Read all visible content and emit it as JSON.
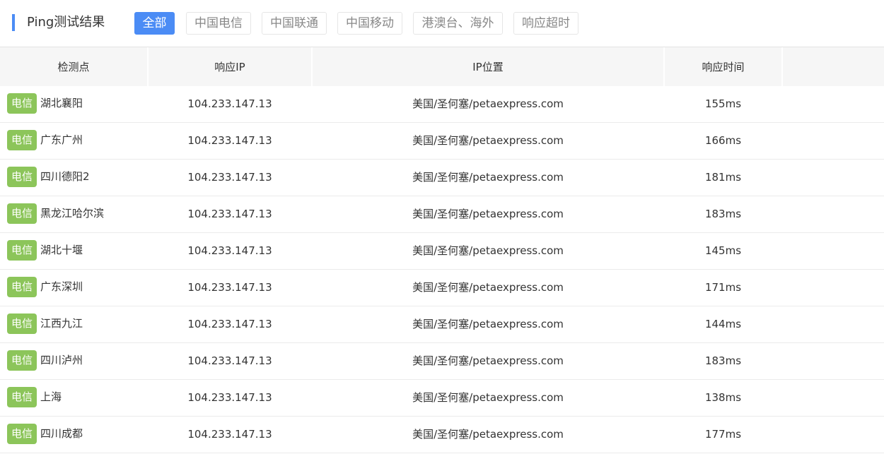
{
  "header": {
    "title": "Ping测试结果",
    "tabs": [
      {
        "label": "全部",
        "active": true
      },
      {
        "label": "中国电信",
        "active": false
      },
      {
        "label": "中国联通",
        "active": false
      },
      {
        "label": "中国移动",
        "active": false
      },
      {
        "label": "港澳台、海外",
        "active": false
      },
      {
        "label": "响应超时",
        "active": false
      }
    ]
  },
  "colors": {
    "accent": "#4b8cf5",
    "isp_badge": "#8cc55a",
    "header_bg": "#f6f6f6"
  },
  "table": {
    "columns": [
      "检测点",
      "响应IP",
      "IP位置",
      "响应时间"
    ],
    "rows": [
      {
        "isp": "电信",
        "point": "湖北襄阳",
        "ip": "104.233.147.13",
        "location": "美国/圣何塞/petaexpress.com",
        "time": "155ms"
      },
      {
        "isp": "电信",
        "point": "广东广州",
        "ip": "104.233.147.13",
        "location": "美国/圣何塞/petaexpress.com",
        "time": "166ms"
      },
      {
        "isp": "电信",
        "point": "四川德阳2",
        "ip": "104.233.147.13",
        "location": "美国/圣何塞/petaexpress.com",
        "time": "181ms"
      },
      {
        "isp": "电信",
        "point": "黑龙江哈尔滨",
        "ip": "104.233.147.13",
        "location": "美国/圣何塞/petaexpress.com",
        "time": "183ms"
      },
      {
        "isp": "电信",
        "point": "湖北十堰",
        "ip": "104.233.147.13",
        "location": "美国/圣何塞/petaexpress.com",
        "time": "145ms"
      },
      {
        "isp": "电信",
        "point": "广东深圳",
        "ip": "104.233.147.13",
        "location": "美国/圣何塞/petaexpress.com",
        "time": "171ms"
      },
      {
        "isp": "电信",
        "point": "江西九江",
        "ip": "104.233.147.13",
        "location": "美国/圣何塞/petaexpress.com",
        "time": "144ms"
      },
      {
        "isp": "电信",
        "point": "四川泸州",
        "ip": "104.233.147.13",
        "location": "美国/圣何塞/petaexpress.com",
        "time": "183ms"
      },
      {
        "isp": "电信",
        "point": "上海",
        "ip": "104.233.147.13",
        "location": "美国/圣何塞/petaexpress.com",
        "time": "138ms"
      },
      {
        "isp": "电信",
        "point": "四川成都",
        "ip": "104.233.147.13",
        "location": "美国/圣何塞/petaexpress.com",
        "time": "177ms"
      }
    ]
  }
}
